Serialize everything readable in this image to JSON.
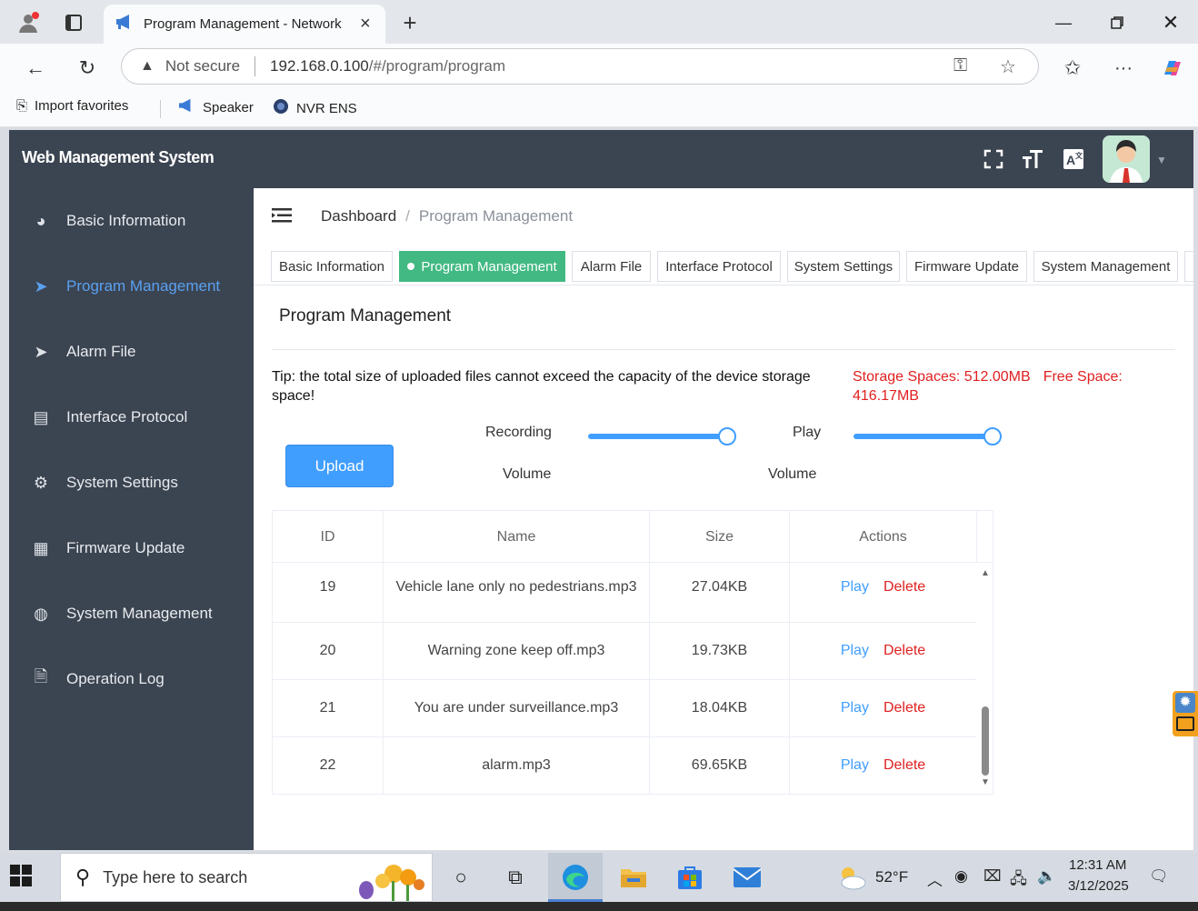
{
  "browser": {
    "tab_title": "Program Management - Network",
    "new_tab": "+",
    "not_secure": "Not secure",
    "url_host": "192.168.0.100",
    "url_path": "/#/program/program",
    "bookmarks": [
      {
        "label": "Import favorites",
        "icon": "import-icon"
      },
      {
        "label": "Speaker",
        "icon": "megaphone-icon"
      },
      {
        "label": "NVR ENS",
        "icon": "globe-icon"
      }
    ]
  },
  "app": {
    "title": "Web Management System",
    "sidebar": [
      {
        "label": "Basic Information",
        "icon": "dashboard-icon",
        "active": false
      },
      {
        "label": "Program Management",
        "icon": "send-icon",
        "active": true
      },
      {
        "label": "Alarm File",
        "icon": "send-icon",
        "active": false
      },
      {
        "label": "Interface Protocol",
        "icon": "document-icon",
        "active": false
      },
      {
        "label": "System Settings",
        "icon": "gear-icon",
        "active": false
      },
      {
        "label": "Firmware Update",
        "icon": "grid-icon",
        "active": false
      },
      {
        "label": "System Management",
        "icon": "globe-icon",
        "active": false
      },
      {
        "label": "Operation Log",
        "icon": "log-icon",
        "active": false
      }
    ],
    "breadcrumb": {
      "root": "Dashboard",
      "separator": "/",
      "current": "Program Management"
    },
    "tags": [
      {
        "label": "Basic Information",
        "active": false
      },
      {
        "label": "Program Management",
        "active": true
      },
      {
        "label": "Alarm File",
        "active": false
      },
      {
        "label": "Interface Protocol",
        "active": false
      },
      {
        "label": "System Settings",
        "active": false
      },
      {
        "label": "Firmware Update",
        "active": false
      },
      {
        "label": "System Management",
        "active": false
      }
    ],
    "section_title": "Program Management",
    "tip": "Tip: the total size of uploaded files cannot exceed the capacity of the device storage space!",
    "storage": {
      "total": "Storage Spaces: 512.00MB",
      "free": "Free Space: 416.17MB"
    },
    "upload_label": "Upload",
    "recording_volume": {
      "label_top": "Recording",
      "label_bottom": "Volume",
      "level": 1.0
    },
    "play_volume": {
      "label_top": "Play",
      "label_bottom": "Volume",
      "level": 1.0
    },
    "table": {
      "headers": [
        "ID",
        "Name",
        "Size",
        "Actions"
      ],
      "rows": [
        {
          "id": "19",
          "name": "Vehicle lane only no pedestrians.mp3",
          "size": "27.04KB",
          "play": "Play",
          "delete": "Delete"
        },
        {
          "id": "20",
          "name": "Warning zone keep off.mp3",
          "size": "19.73KB",
          "play": "Play",
          "delete": "Delete"
        },
        {
          "id": "21",
          "name": "You are under surveillance.mp3",
          "size": "18.04KB",
          "play": "Play",
          "delete": "Delete"
        },
        {
          "id": "22",
          "name": "alarm.mp3",
          "size": "69.65KB",
          "play": "Play",
          "delete": "Delete"
        }
      ]
    }
  },
  "taskbar": {
    "search_placeholder": "Type here to search",
    "temperature": "52°F",
    "time": "12:31 AM",
    "date": "3/12/2025"
  },
  "colors": {
    "header_bg": "#3b4451",
    "active_blue": "#409eff",
    "tag_active_green": "#42b983",
    "warning_red": "#e02020"
  }
}
